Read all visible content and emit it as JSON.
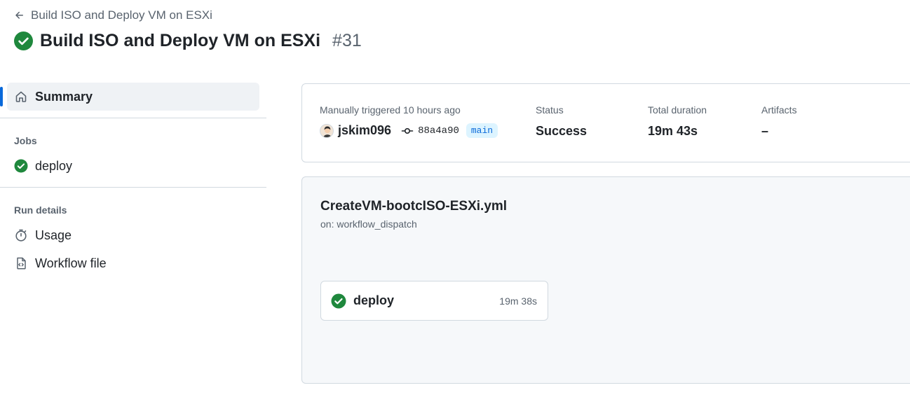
{
  "header": {
    "back_label": "Build ISO and Deploy VM on ESXi",
    "title": "Build ISO and Deploy VM on ESXi",
    "run_number": "#31",
    "status_icon": "check-circle-fill-icon"
  },
  "sidebar": {
    "summary_label": "Summary",
    "jobs_heading": "Jobs",
    "jobs": [
      {
        "label": "deploy",
        "icon": "check-circle-fill-icon"
      }
    ],
    "run_details_heading": "Run details",
    "run_details": [
      {
        "label": "Usage",
        "icon": "stopwatch-icon"
      },
      {
        "label": "Workflow file",
        "icon": "file-code-icon"
      }
    ]
  },
  "summary": {
    "trigger_label": "Manually triggered 10 hours ago",
    "username": "jskim096",
    "commit_sha": "88a4a90",
    "branch": "main",
    "status_label": "Status",
    "status_value": "Success",
    "duration_label": "Total duration",
    "duration_value": "19m 43s",
    "artifacts_label": "Artifacts",
    "artifacts_value": "–"
  },
  "workflow": {
    "file_name": "CreateVM-bootcISO-ESXi.yml",
    "trigger": "on: workflow_dispatch",
    "jobs": [
      {
        "name": "deploy",
        "duration": "19m 38s",
        "status": "success"
      }
    ]
  },
  "colors": {
    "success": "#1f883d",
    "accent": "#0969da",
    "muted": "#59636e",
    "border": "#d1d9e0"
  }
}
